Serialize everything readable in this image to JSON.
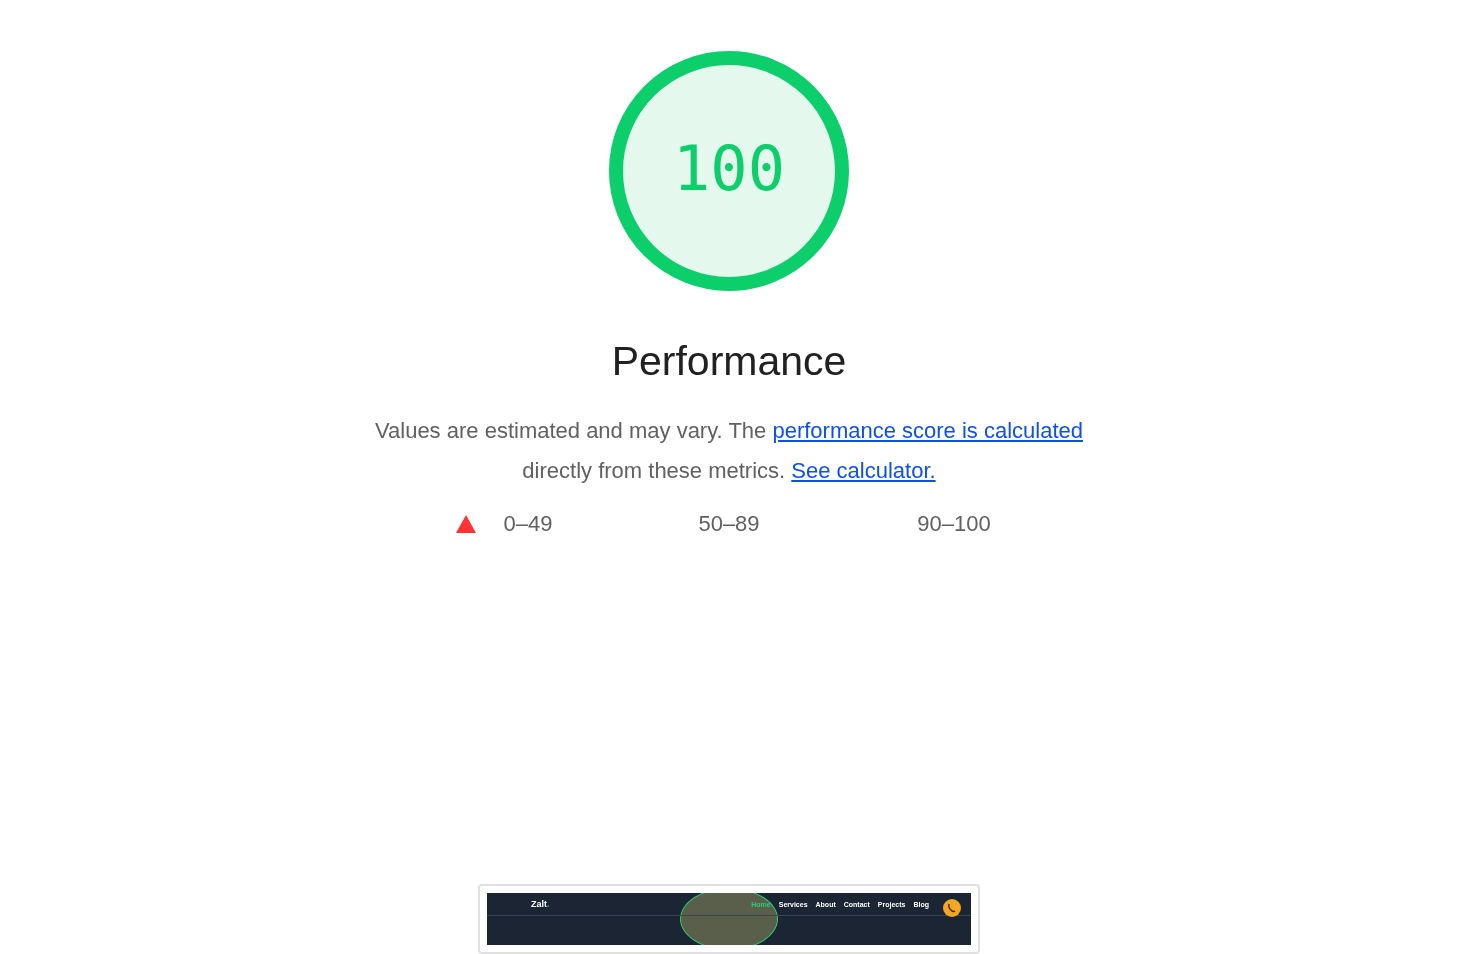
{
  "gauge": {
    "score": "100",
    "level": 1
  },
  "category_title": "Performance",
  "description": [
    {
      "kind": "text",
      "text": "Values are estimated and may vary. The "
    },
    {
      "kind": "link",
      "text": "performance score is calculated"
    },
    {
      "kind": "text",
      "text": " directly from these metrics. "
    },
    {
      "kind": "link",
      "text": "See calculator."
    }
  ],
  "legend": [
    {
      "kind": "fail",
      "label": "0–49"
    },
    {
      "kind": "average",
      "label": "50–89"
    },
    {
      "kind": "pass",
      "label": "90–100"
    }
  ],
  "screenshot": {
    "logo": "Zalt",
    "logo_mark": ".",
    "nav": [
      {
        "label": "Home",
        "selected": true
      },
      {
        "label": "Services",
        "selected": false
      },
      {
        "label": "About",
        "selected": false
      },
      {
        "label": "Contact",
        "selected": false
      },
      {
        "label": "Projects",
        "selected": false
      },
      {
        "label": "Blog",
        "selected": false
      }
    ]
  }
}
